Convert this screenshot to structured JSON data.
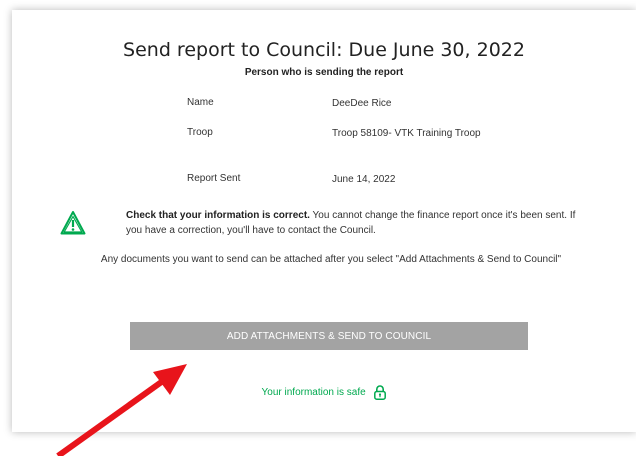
{
  "dialog": {
    "title": "Send report to Council: Due June 30, 2022",
    "subtitle": "Person who is sending the report"
  },
  "details": [
    {
      "label": "Name",
      "value": "DeeDee Rice"
    },
    {
      "label": "Troop",
      "value": "Troop 58109- VTK Training Troop"
    },
    {
      "label": "Report Sent",
      "value": "June 14, 2022"
    }
  ],
  "warning": {
    "bold": "Check that your information is correct.",
    "text": " You cannot change the finance report once it's been sent. If you have a correction, you'll have to contact the Council.",
    "icon": "warning-triangle-icon",
    "color": "#00a94f"
  },
  "attachments_note": "Any documents you want to send can be attached after you select \"Add Attachments & Send to Council\"",
  "send_button": {
    "label": "ADD ATTACHMENTS & SEND TO COUNCIL",
    "color": "#a3a3a3"
  },
  "safe_note": {
    "label": "Your information is safe",
    "icon": "lock-icon",
    "color": "#00a94f"
  },
  "annotation": {
    "icon": "red-arrow",
    "color": "#e8141b"
  }
}
